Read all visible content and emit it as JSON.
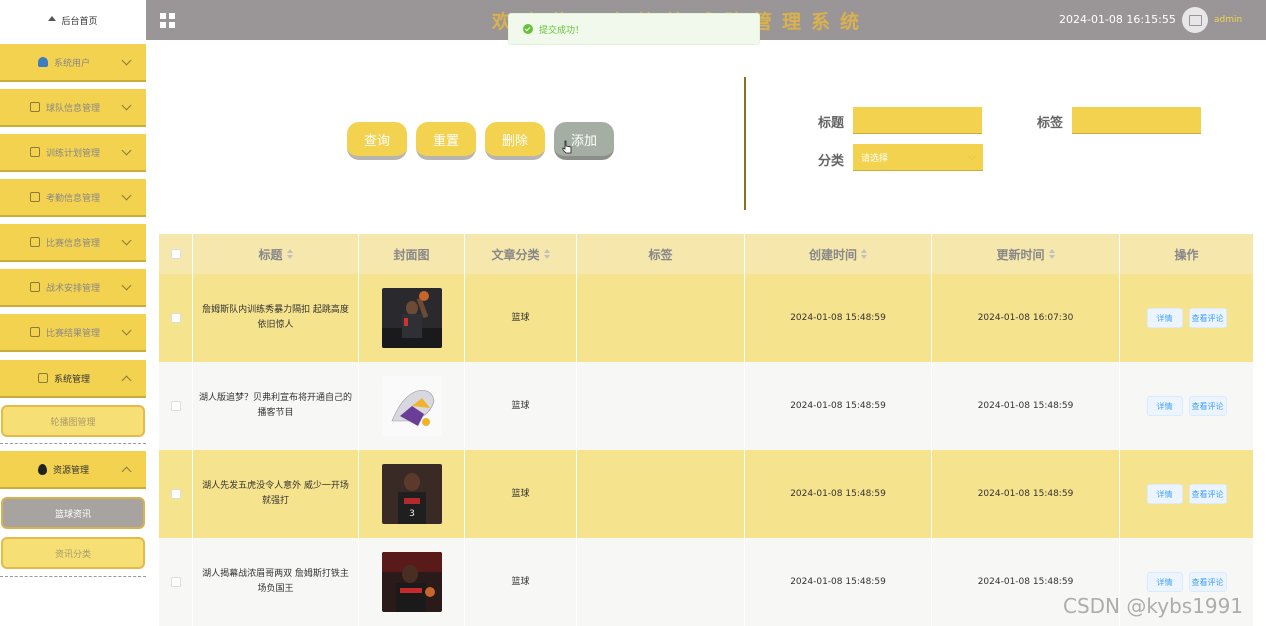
{
  "sidebar": {
    "home_label": "后台首页",
    "items": [
      {
        "label": "系统用户"
      },
      {
        "label": "球队信息管理"
      },
      {
        "label": "训练计划管理"
      },
      {
        "label": "考勤信息管理"
      },
      {
        "label": "比赛信息管理"
      },
      {
        "label": "战术安排管理"
      },
      {
        "label": "比赛结果管理"
      },
      {
        "label": "系统管理"
      },
      {
        "label": "资源管理"
      }
    ],
    "sub_items": [
      {
        "label": "轮播图管理"
      },
      {
        "label": "篮球资讯"
      },
      {
        "label": "资讯分类"
      }
    ]
  },
  "header": {
    "title": "欢迎使用高校篮球队管理系统",
    "datetime": "2024-01-08 16:15:55",
    "username": "admin"
  },
  "toast": {
    "message": "提交成功！"
  },
  "actions": {
    "query": "查询",
    "reset": "重置",
    "delete": "删除",
    "add": "添加"
  },
  "search": {
    "title_label": "标题",
    "tag_label": "标签",
    "category_label": "分类",
    "category_placeholder": "请选择"
  },
  "table": {
    "headers": [
      "标题",
      "封面图",
      "文章分类",
      "标签",
      "创建时间",
      "更新时间",
      "操作"
    ],
    "rows": [
      {
        "title": "詹姆斯队内训练秀暴力隔扣 起跳高度依旧惊人",
        "category": "篮球",
        "tag": "",
        "created": "2024-01-08 15:48:59",
        "updated": "2024-01-08 16:07:30"
      },
      {
        "title": "湖人版追梦？贝弗利宣布将开通自己的播客节目",
        "category": "篮球",
        "tag": "",
        "created": "2024-01-08 15:48:59",
        "updated": "2024-01-08 15:48:59"
      },
      {
        "title": "湖人先发五虎没令人意外 威少一开场就强打",
        "category": "篮球",
        "tag": "",
        "created": "2024-01-08 15:48:59",
        "updated": "2024-01-08 15:48:59"
      },
      {
        "title": "湖人揭幕战浓眉哥两双 詹姆斯打铁主场负国王",
        "category": "篮球",
        "tag": "",
        "created": "2024-01-08 15:48:59",
        "updated": "2024-01-08 15:48:59"
      }
    ],
    "detail_label": "详情",
    "comments_label": "查看评论"
  },
  "watermark": "CSDN @kybs1991",
  "colors": {
    "accent": "#f3d24f",
    "header_bg": "#9a9597",
    "row_alt": "#f6e38d",
    "table_head": "#f6e7ad"
  }
}
